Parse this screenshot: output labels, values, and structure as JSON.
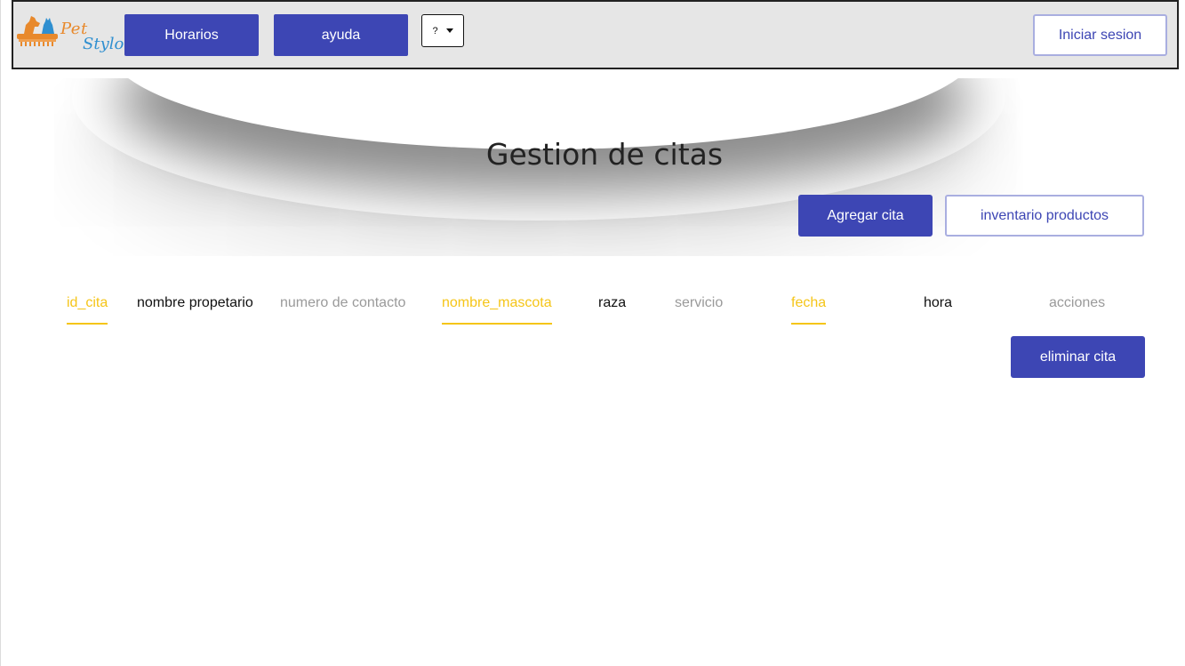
{
  "navbar": {
    "logo_word_1": "Pet",
    "logo_word_2": "Stylo",
    "horarios_label": "Horarios",
    "ayuda_label": "ayuda",
    "dropdown_value": "?",
    "login_label": "Iniciar sesion"
  },
  "main": {
    "title": "Gestion de citas",
    "add_label": "Agregar cita",
    "inventory_label": "inventario productos",
    "delete_label": "eliminar cita"
  },
  "table": {
    "columns": [
      {
        "label": "id_cita",
        "state": "active"
      },
      {
        "label": "nombre propetario",
        "state": "dark"
      },
      {
        "label": "numero de contacto",
        "state": "muted"
      },
      {
        "label": "nombre_mascota",
        "state": "active"
      },
      {
        "label": "raza",
        "state": "dark"
      },
      {
        "label": "servicio",
        "state": "muted"
      },
      {
        "label": "fecha",
        "state": "active"
      },
      {
        "label": "hora",
        "state": "dark"
      },
      {
        "label": "acciones",
        "state": "muted"
      }
    ]
  },
  "colors": {
    "primary": "#3d46b4",
    "active_tab": "#f5c518",
    "muted_text": "#9a9a9a",
    "navbar_bg": "#e6e6e6"
  }
}
